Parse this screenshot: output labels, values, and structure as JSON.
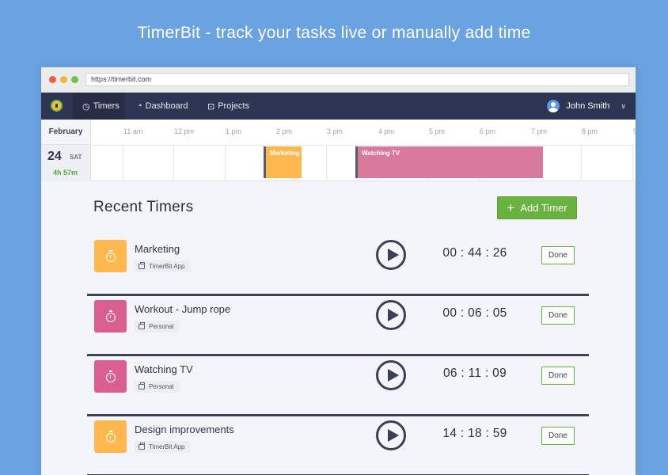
{
  "headline": "TimerBit - track your tasks live or manually add time",
  "browser": {
    "url": "https://timerbit.com"
  },
  "nav": {
    "items": [
      {
        "label": "Timers",
        "icon": "stopwatch-icon",
        "active": true
      },
      {
        "label": "Dashboard",
        "icon": "pie-chart-icon",
        "active": false
      },
      {
        "label": "Projects",
        "icon": "briefcase-icon",
        "active": false
      }
    ],
    "user": {
      "name": "John Smith"
    }
  },
  "timeline": {
    "month": "February",
    "day": {
      "number": "24",
      "weekday": "SAT",
      "total": "4h 57m"
    },
    "hours": [
      "11 am",
      "12 pm",
      "1 pm",
      "2 pm",
      "3 pm",
      "4 pm",
      "5 pm",
      "6 pm",
      "7 pm",
      "8 pm",
      "9"
    ],
    "events": [
      {
        "label": "Marketing",
        "color": "#ffb84d"
      },
      {
        "label": "Watching TV",
        "color": "#d9799c"
      }
    ]
  },
  "recent": {
    "title": "Recent Timers",
    "add_button": "Add Timer",
    "timers": [
      {
        "name": "Marketing",
        "project": "TimerBit App",
        "time": "00 : 44 : 26",
        "color": "#ffb84d",
        "action": "Done"
      },
      {
        "name": "Workout - Jump rope",
        "project": "Personal",
        "time": "00 : 06 : 05",
        "color": "#d9608e",
        "action": "Done"
      },
      {
        "name": "Watching TV",
        "project": "Personal",
        "time": "06 : 11 : 09",
        "color": "#d9608e",
        "action": "Done"
      },
      {
        "name": "Design improvements",
        "project": "TimerBit App",
        "time": "14 : 18 : 59",
        "color": "#ffb84d",
        "action": "Done"
      }
    ]
  },
  "colors": {
    "accent": "#6ab23f",
    "navbar": "#2d3552",
    "background": "#6aa3e0"
  }
}
